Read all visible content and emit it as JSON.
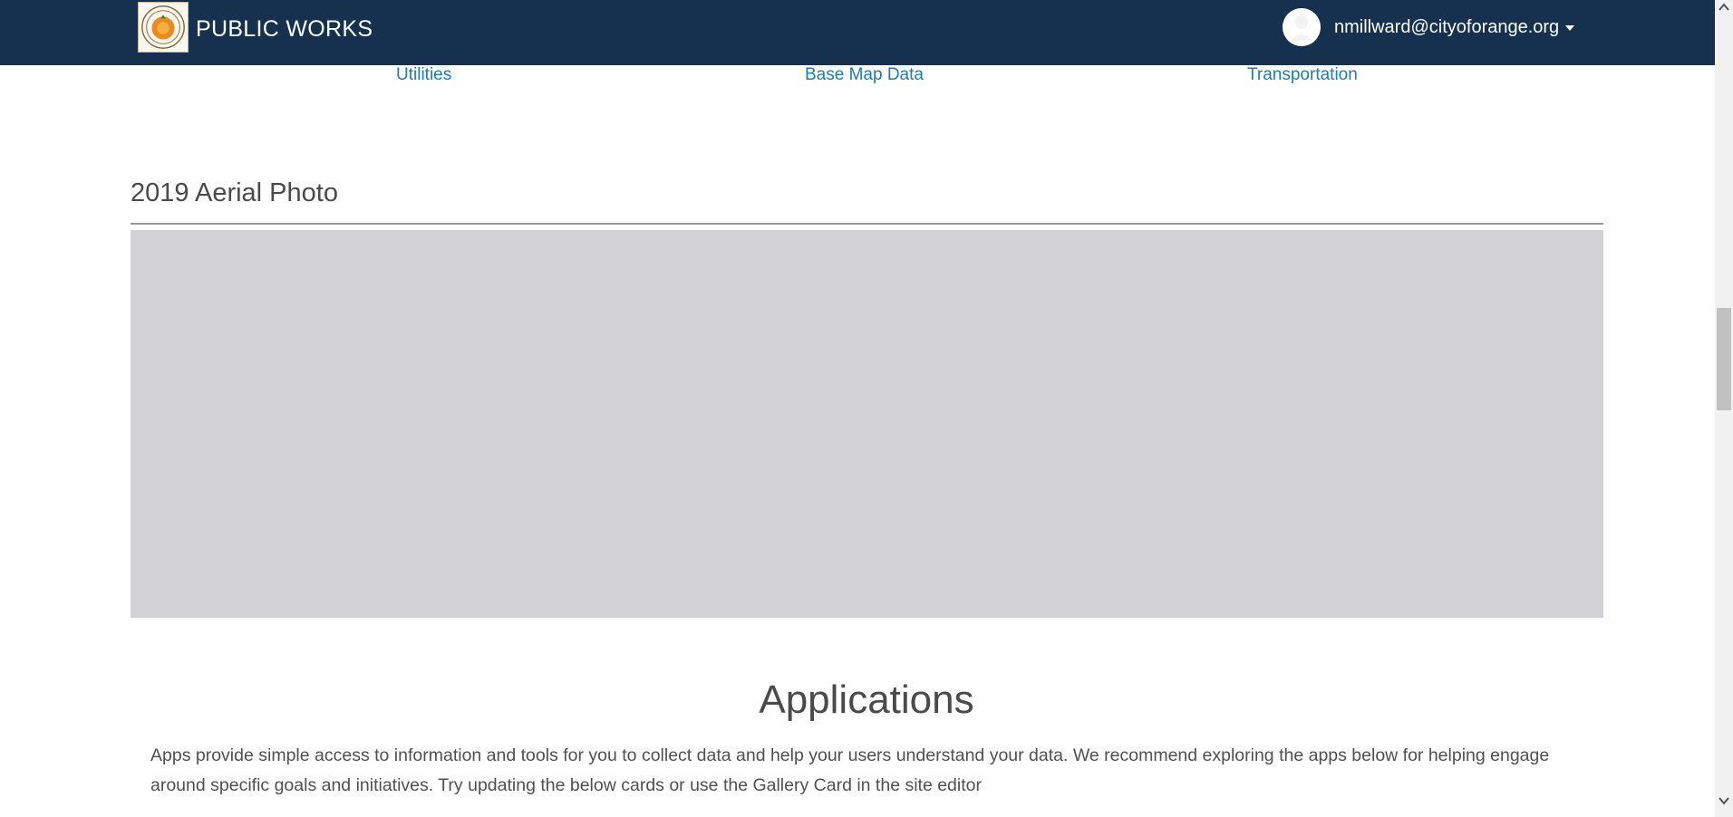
{
  "header": {
    "brand": "PUBLIC WORKS",
    "logo_icon": "city-seal-icon",
    "user_email": "nmillward@cityoforange.org",
    "avatar_icon": "user-avatar-icon",
    "dropdown_icon": "caret-down-icon",
    "background_color": "#15314f"
  },
  "categories": [
    {
      "label": "Utilities"
    },
    {
      "label": "Base Map Data"
    },
    {
      "label": "Transportation"
    }
  ],
  "aerial": {
    "title": "2019 Aerial Photo"
  },
  "applications": {
    "title": "Applications",
    "description": "Apps provide simple access to information and tools for you to collect data and help your users understand your data. We recommend exploring the apps below for helping engage around specific goals and initiatives. Try updating the below cards or use the Gallery Card in the site editor"
  },
  "colors": {
    "link": "#1d7bb5",
    "map_placeholder": "#d1d1d6"
  }
}
